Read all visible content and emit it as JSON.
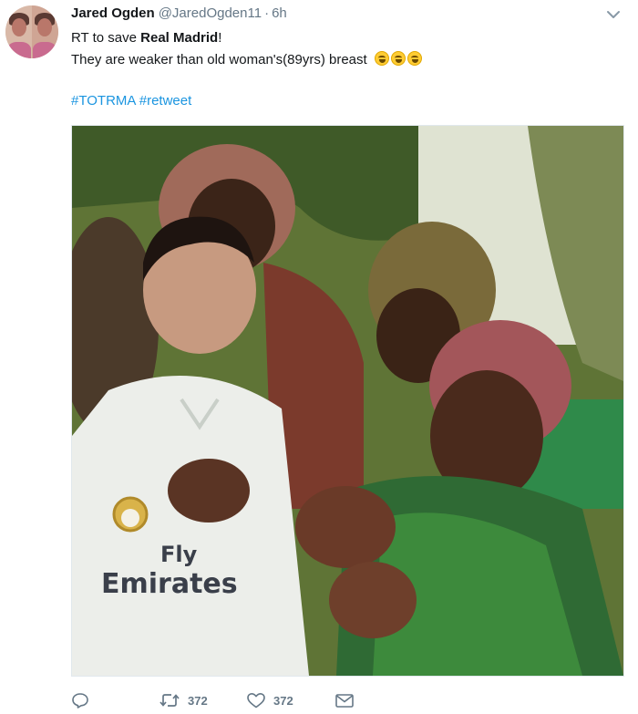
{
  "tweet": {
    "author_name": "Jared Ogden",
    "author_handle": "@JaredOgden11",
    "separator": "·",
    "time": "6h",
    "text_line1_prefix": "RT to save ",
    "text_line1_bold": "Real Madrid",
    "text_line1_suffix": "!",
    "text_line2": "They are weaker than old woman's(89yrs) breast",
    "emoji_name": "face-with-tears-of-joy",
    "emoji_count": 3,
    "hashtags": [
      "#TOTRMA",
      "#retweet"
    ],
    "image_text": {
      "sponsor_line1": "Fly",
      "sponsor_line2": "Emirates"
    }
  },
  "actions": {
    "reply_icon": "reply-icon",
    "retweet_icon": "retweet-icon",
    "retweet_count": "372",
    "like_icon": "heart-icon",
    "like_count": "372",
    "dm_icon": "envelope-icon"
  },
  "colors": {
    "link": "#1b95e0",
    "muted": "#657786",
    "text": "#14171a"
  }
}
